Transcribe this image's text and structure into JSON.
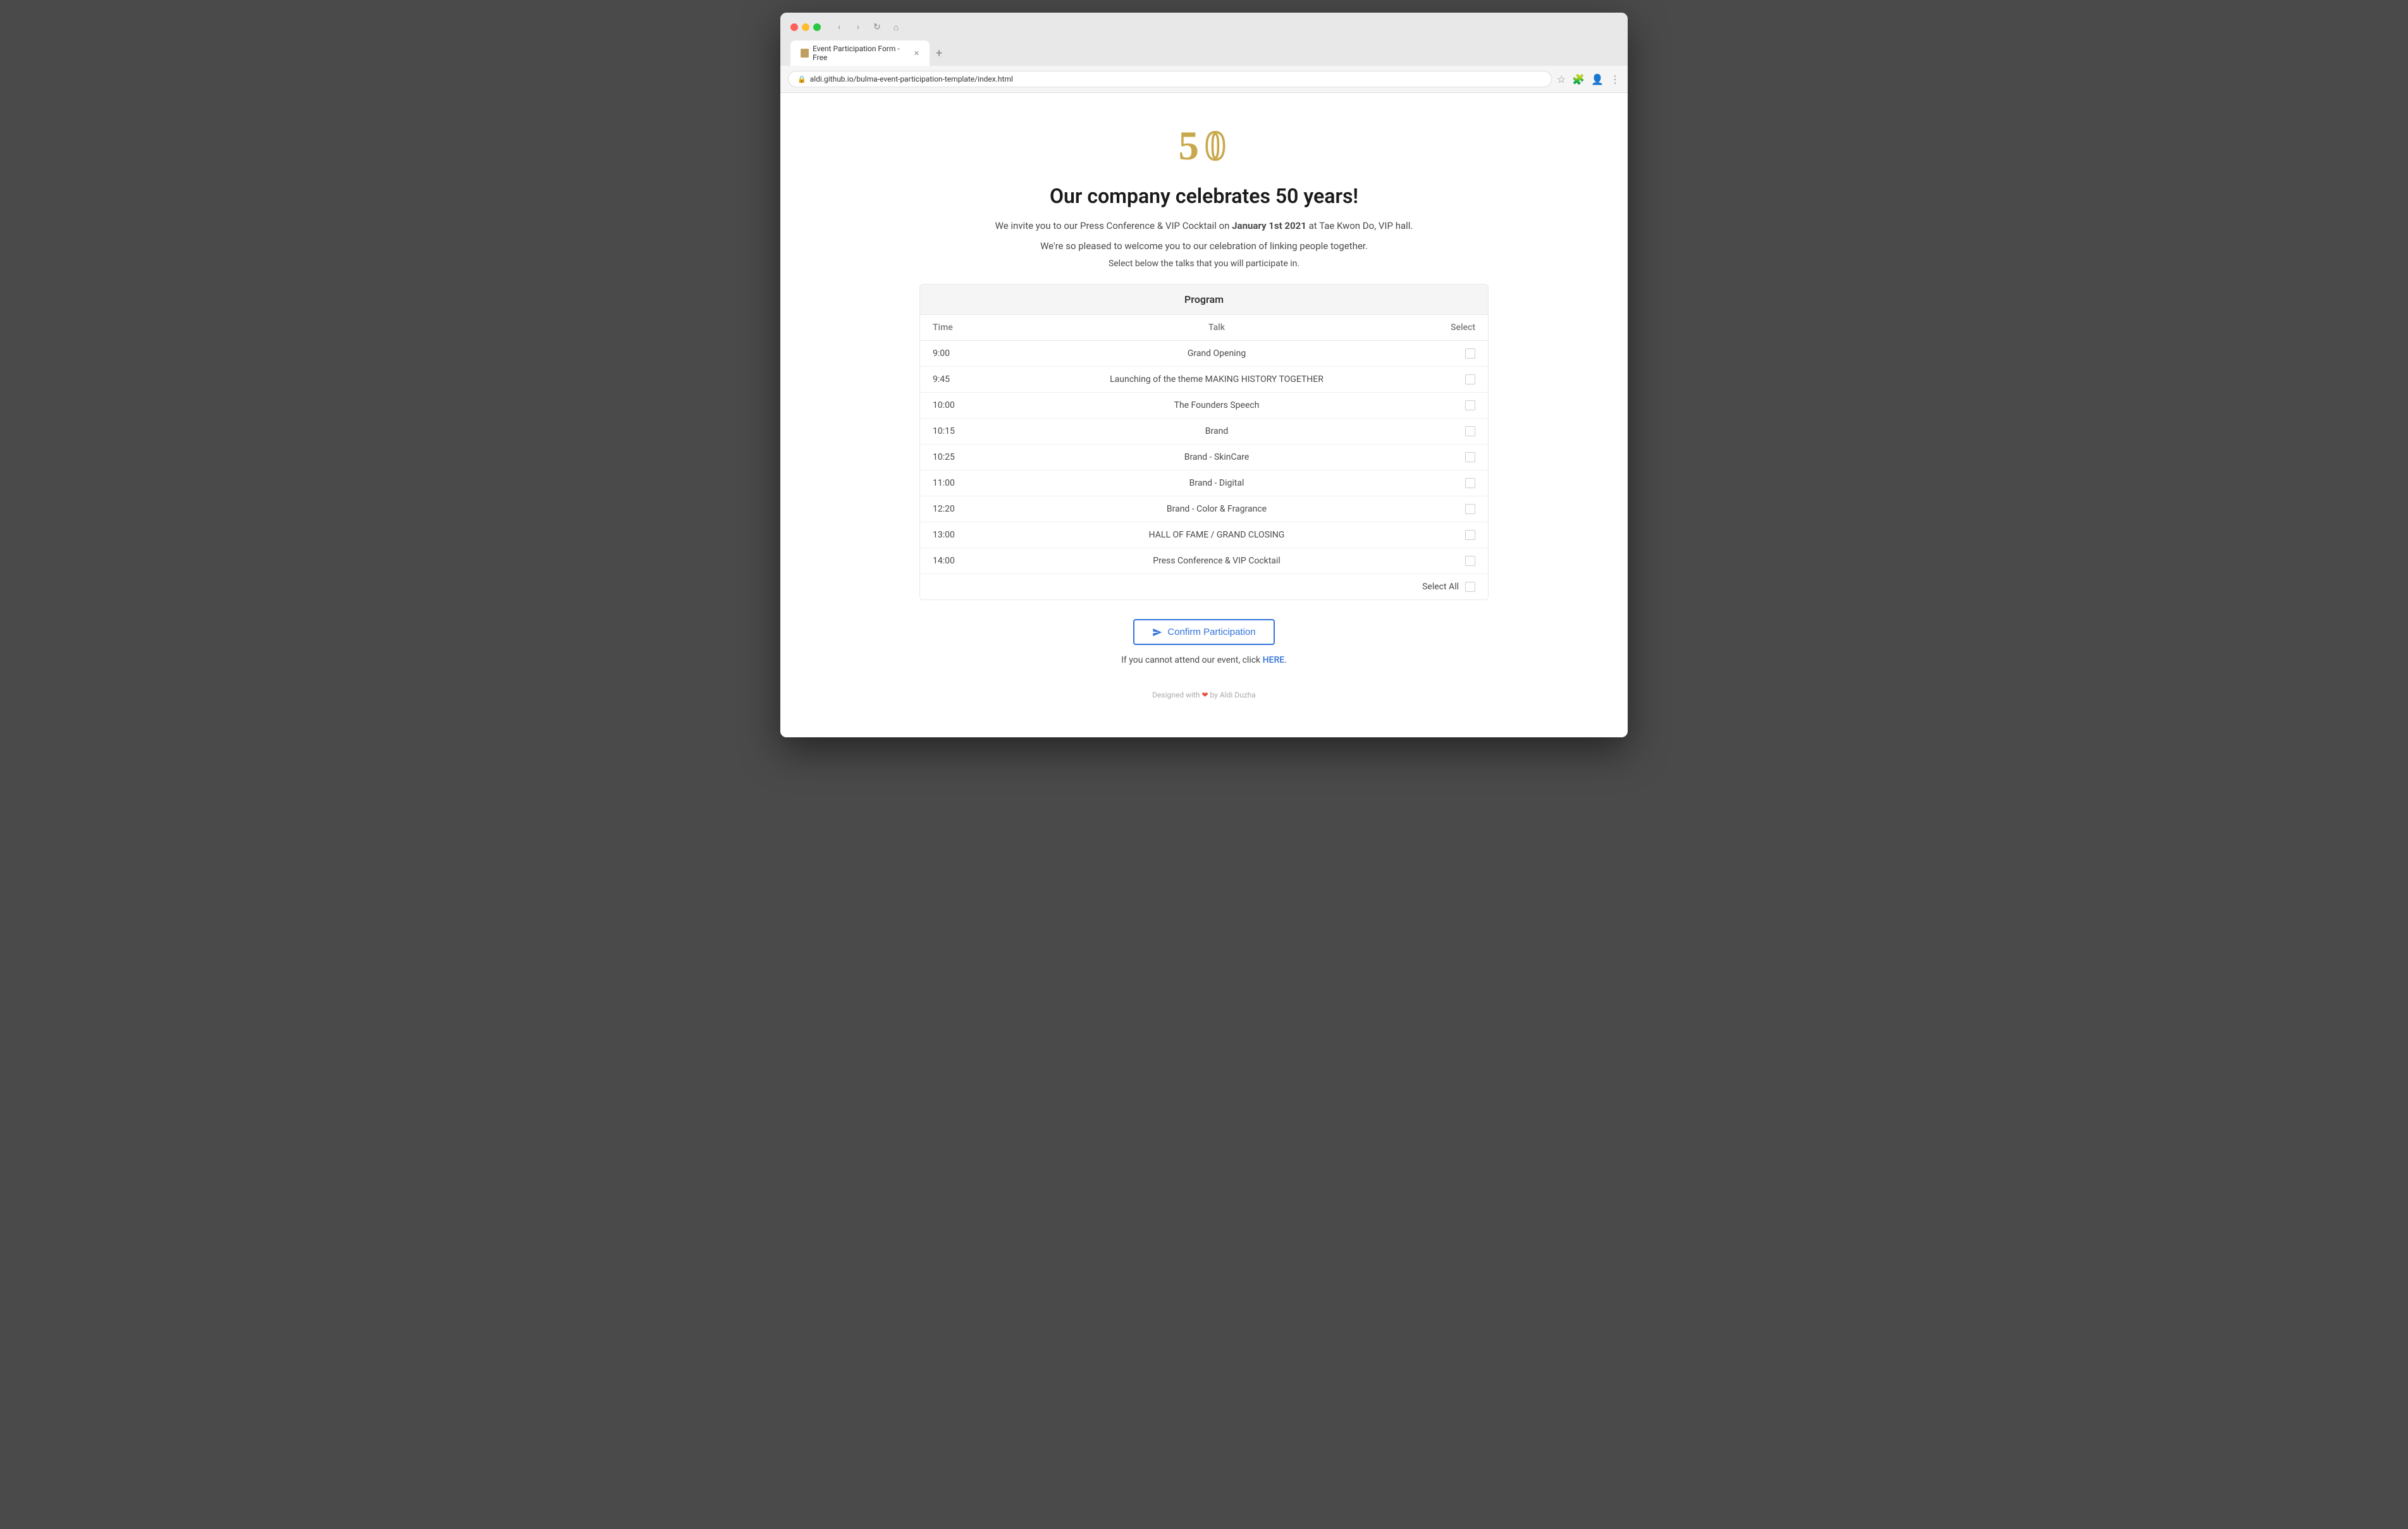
{
  "browser": {
    "tab_title": "Event Participation Form - Free",
    "tab_new_label": "+",
    "address": "aldi.github.io/bulma-event-participation-template/index.html"
  },
  "page": {
    "logo_alt": "50th anniversary logo",
    "main_title": "Our company celebrates 50 years!",
    "subtitle_line1": "We invite you to our Press Conference & VIP Cocktail on",
    "subtitle_bold": "January 1st 2021",
    "subtitle_line1_end": "at Tae Kwon Do, VIP hall.",
    "subtitle_line2": "We're so pleased to welcome you to our celebration of linking people together.",
    "select_instruction": "Select below the talks that you will participate in.",
    "program": {
      "header": "Program",
      "col_time": "Time",
      "col_talk": "Talk",
      "col_select": "Select",
      "rows": [
        {
          "time": "9:00",
          "talk": "Grand Opening"
        },
        {
          "time": "9:45",
          "talk": "Launching of the theme MAKING HISTORY TOGETHER"
        },
        {
          "time": "10:00",
          "talk": "The Founders Speech"
        },
        {
          "time": "10:15",
          "talk": "Brand"
        },
        {
          "time": "10:25",
          "talk": "Brand - SkinCare"
        },
        {
          "time": "11:00",
          "talk": "Brand - Digital"
        },
        {
          "time": "12:20",
          "talk": "Brand - Color & Fragrance"
        },
        {
          "time": "13:00",
          "talk": "HALL OF FAME / GRAND CLOSING"
        },
        {
          "time": "14:00",
          "talk": "Press Conference & VIP Cocktail"
        }
      ],
      "select_all_label": "Select All"
    },
    "confirm_button": "Confirm Participation",
    "attendance_note_prefix": "If you cannot attend our event, click ",
    "attendance_link": "HERE",
    "attendance_note_suffix": ".",
    "footer": "Designed with ❤ by Aldi Duzha"
  }
}
